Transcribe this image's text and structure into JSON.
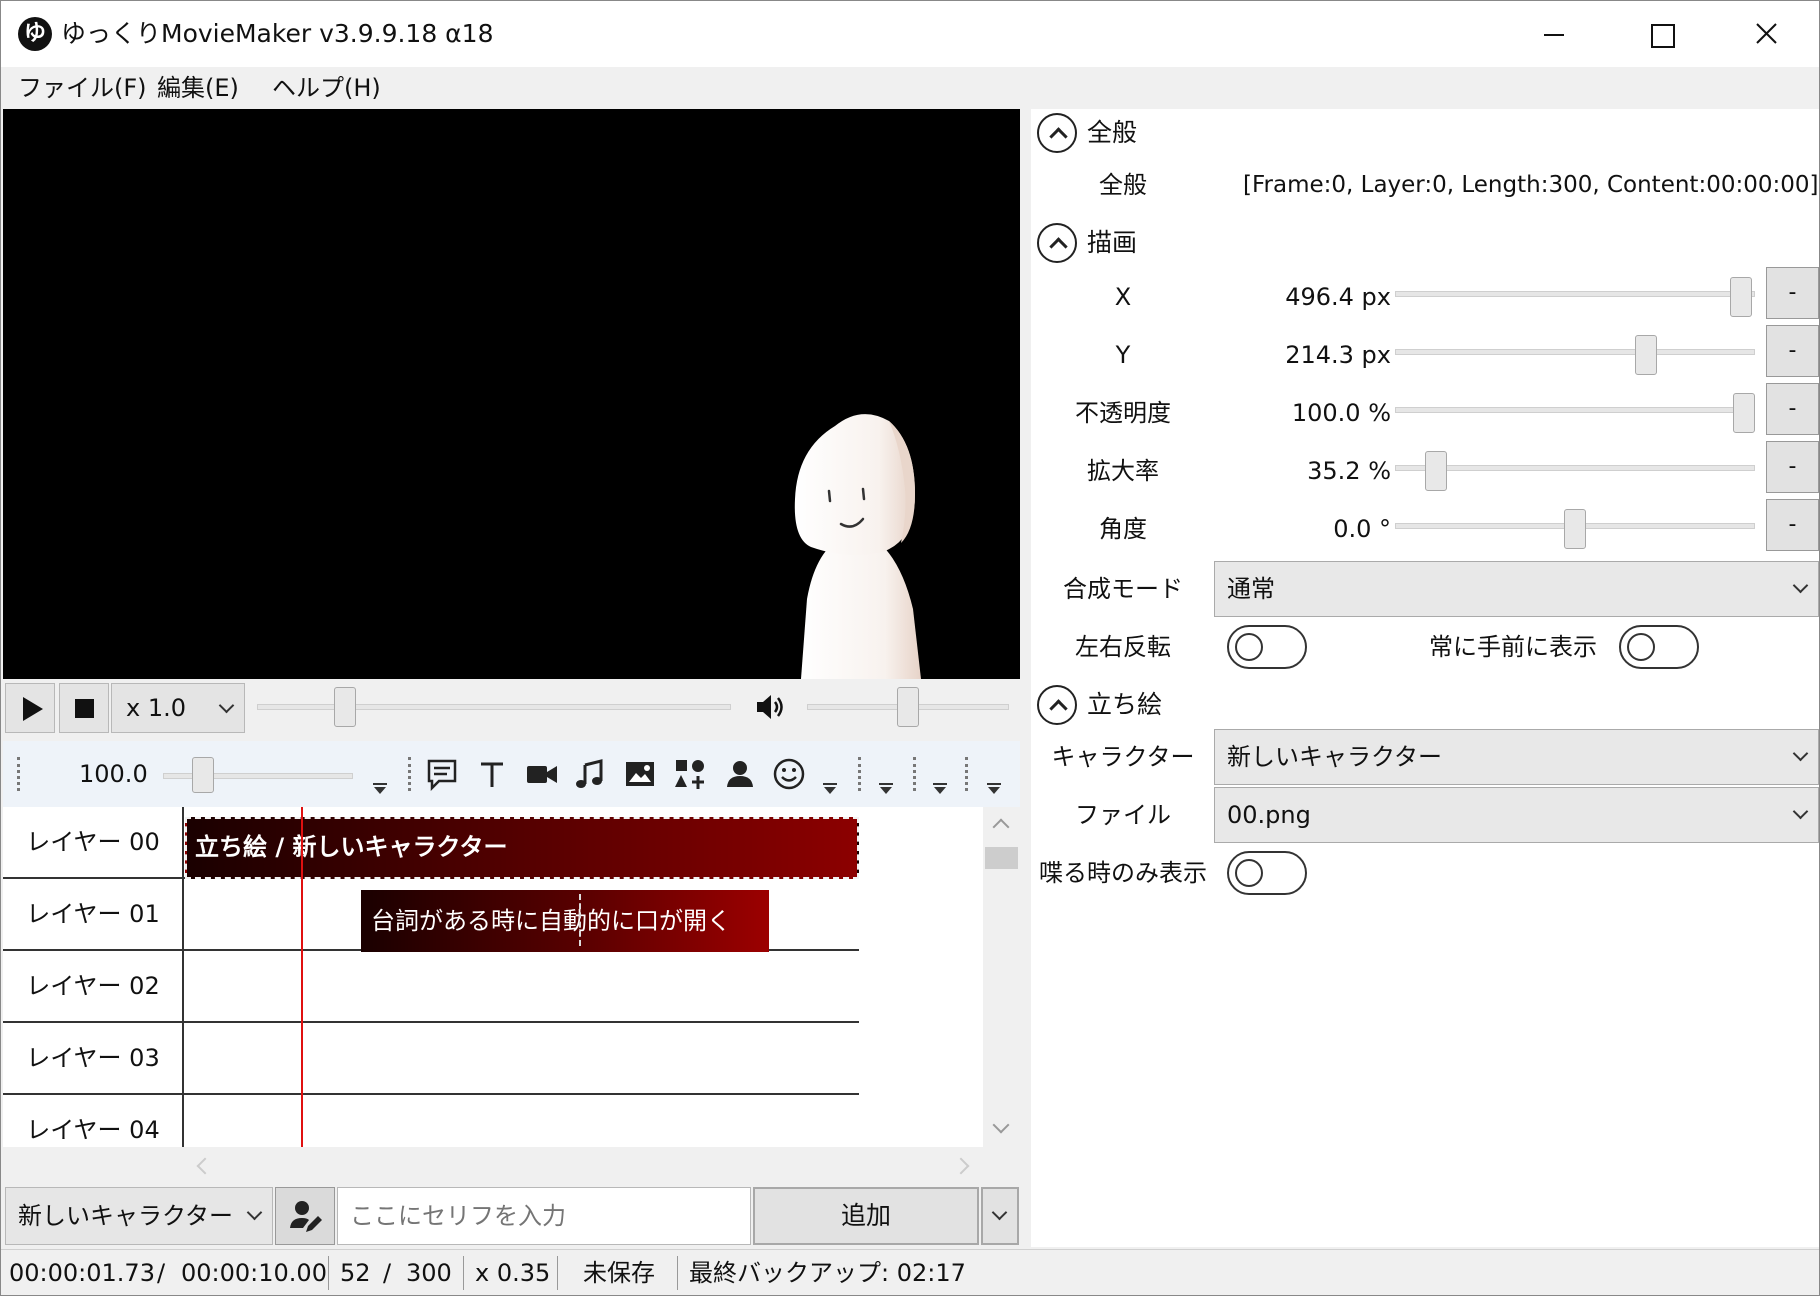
{
  "window": {
    "title": "ゆっくりMovieMaker v3.9.9.18 α18",
    "app_icon_glyph": "ゆ"
  },
  "menu": {
    "file": "ファイル(F)",
    "edit": "編集(E)",
    "help": "ヘルプ(H)"
  },
  "playback": {
    "speed": "x 1.0",
    "seek_position": 0.17,
    "volume_level": 0.5
  },
  "timeline_toolbar": {
    "zoom_value": "100.0",
    "zoom_level": 0.17
  },
  "timeline": {
    "layers": [
      "レイヤー 00",
      "レイヤー 01",
      "レイヤー 02",
      "レイヤー 03",
      "レイヤー 04"
    ],
    "clips": [
      {
        "layer": 0,
        "text": "立ち絵 / 新しいキャラクター"
      },
      {
        "layer": 1,
        "text": "台詞がある時に自動的に口が開く"
      }
    ]
  },
  "input_row": {
    "character": "新しいキャラクター",
    "serif_placeholder": "ここにセリフを入力",
    "add_label": "追加"
  },
  "status": {
    "current_time": "00:00:01.73",
    "sep1": "/",
    "total_time": "00:00:10.00",
    "current_frame": "52",
    "sep2": "/",
    "total_frames": "300",
    "zoom": "x 0.35",
    "save_state": "未保存",
    "backup": "最終バックアップ: 02:17"
  },
  "props": {
    "general": {
      "section_title": "全般",
      "label": "全般",
      "value": "[Frame:0, Layer:0, Length:300, Content:00:00:00]"
    },
    "drawing": {
      "section_title": "描画",
      "rows": [
        {
          "label": "X",
          "value": "496.4 px",
          "slider": 0.99,
          "reset": "-"
        },
        {
          "label": "Y",
          "value": "214.3 px",
          "slider": 0.71,
          "reset": "-"
        },
        {
          "label": "不透明度",
          "value": "100.0 %",
          "slider": 1.0,
          "reset": "-"
        },
        {
          "label": "拡大率",
          "value": "35.2 %",
          "slider": 0.09,
          "reset": "-"
        },
        {
          "label": "角度",
          "value": "0.0 °",
          "slider": 0.5,
          "reset": "-"
        }
      ],
      "blend_label": "合成モード",
      "blend_value": "通常",
      "flip_label": "左右反転",
      "front_label": "常に手前に表示"
    },
    "tachie": {
      "section_title": "立ち絵",
      "character_label": "キャラクター",
      "character_value": "新しいキャラクター",
      "file_label": "ファイル",
      "file_value": "00.png",
      "speak_only_label": "喋る時のみ表示"
    }
  },
  "colors": {
    "clip_dark": "#1a0000",
    "clip_red": "#8c0000",
    "playhead": "#e01010",
    "timeline_toolbar_bg": "#eef3f9"
  }
}
